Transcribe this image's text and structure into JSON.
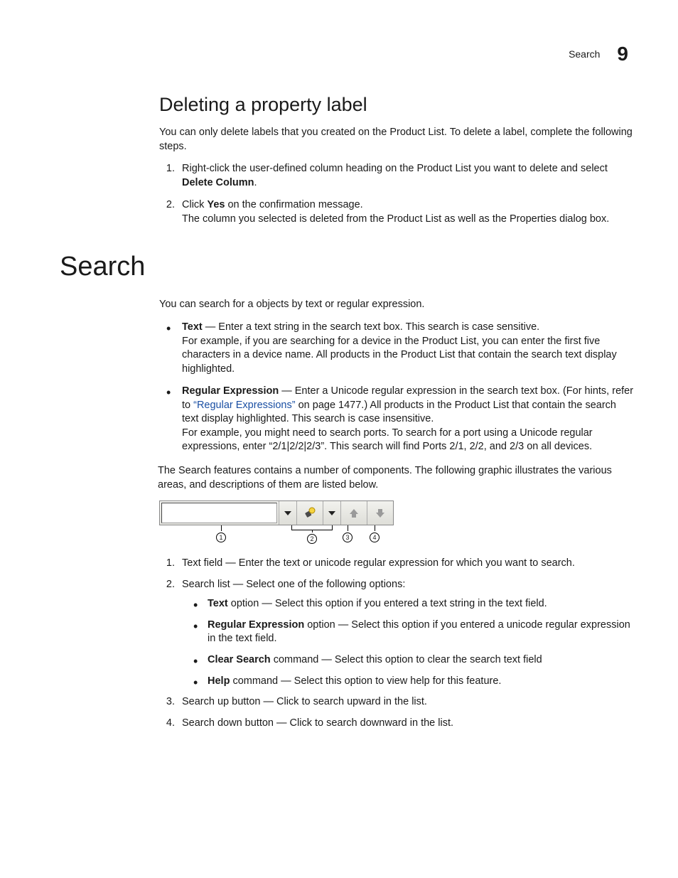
{
  "header": {
    "breadcrumb": "Search",
    "chapter_number": "9"
  },
  "sec1": {
    "title": "Deleting a property label",
    "intro": "You can only delete labels that you created on the Product List. To delete a label, complete the following steps.",
    "step1_a": "Right-click the user-defined column heading on the Product List you want to delete and select ",
    "step1_b": "Delete Column",
    "step1_c": ".",
    "step2_a": "Click ",
    "step2_b": "Yes",
    "step2_c": " on the confirmation message.",
    "step2_note": "The column you selected is deleted from the Product List as well as the Properties dialog box."
  },
  "sec2": {
    "title": "Search",
    "intro": "You can search for a objects by text or regular expression.",
    "bullet_text_label": "Text",
    "bullet_text_desc": " — Enter a text string in the search text box. This search is case sensitive.",
    "bullet_text_example": "For example, if you are searching for a device in the Product List, you can enter the first five characters in a device name. All products in the Product List that contain the search text display highlighted.",
    "bullet_re_label": "Regular Expression",
    "bullet_re_a": " — Enter a Unicode regular expression in the search text box. (For hints, refer to ",
    "bullet_re_link": "“Regular Expressions”",
    "bullet_re_b": " on page 1477.) All products in the Product List that contain the search text display highlighted. This search is case insensitive.",
    "bullet_re_example": "For example, you might need to search ports. To search for a port using a Unicode regular expressions, enter “2/1|2/2|2/3”. This search will find Ports 2/1, 2/2, and 2/3 on all devices.",
    "components_note": "The Search features contains a number of components. The following graphic illustrates the various areas, and descriptions of them are listed below.",
    "callouts": [
      "1",
      "2",
      "3",
      "4"
    ],
    "item1": "Text field — Enter the text or unicode regular expression for which you want to search.",
    "item2_lead": "Search list — Select one of the following options:",
    "item2_opts": {
      "text_l": "Text",
      "text_d": " option — Select this option if you entered a text string in the text field.",
      "re_l": "Regular Expression",
      "re_d": " option — Select this option if you entered a unicode regular expression in the text field.",
      "clr_l": "Clear Search",
      "clr_d": " command — Select this option to clear the search text field",
      "help_l": "Help",
      "help_d": " command — Select this option to view help for this feature."
    },
    "item3": "Search up button — Click to search upward in the list.",
    "item4": "Search down button — Click to search downward in the list."
  }
}
